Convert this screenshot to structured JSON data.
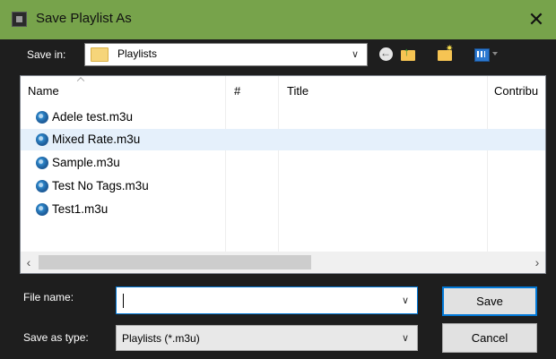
{
  "window": {
    "title": "Save Playlist As",
    "close_glyph": "✕"
  },
  "toolbar": {
    "save_in_label": "Save in:",
    "save_in_value": "Playlists",
    "icons": [
      "back-icon",
      "up-folder-icon",
      "new-folder-icon",
      "view-menu-icon"
    ]
  },
  "list": {
    "columns": [
      "Name",
      "#",
      "Title",
      "Contribu"
    ],
    "files": [
      {
        "name": "Adele test.m3u"
      },
      {
        "name": "Mixed Rate.m3u",
        "selected": true
      },
      {
        "name": "Sample.m3u"
      },
      {
        "name": "Test No Tags.m3u"
      },
      {
        "name": "Test1.m3u"
      }
    ]
  },
  "form": {
    "file_name_label": "File name:",
    "file_name_value": "",
    "save_as_type_label": "Save as type:",
    "save_as_type_value": "Playlists (*.m3u)"
  },
  "buttons": {
    "save": "Save",
    "cancel": "Cancel"
  },
  "colors": {
    "titlebar": "#77a34b",
    "background": "#1e1e1e",
    "selection": "#e5f0fb",
    "accent": "#0078d7"
  }
}
